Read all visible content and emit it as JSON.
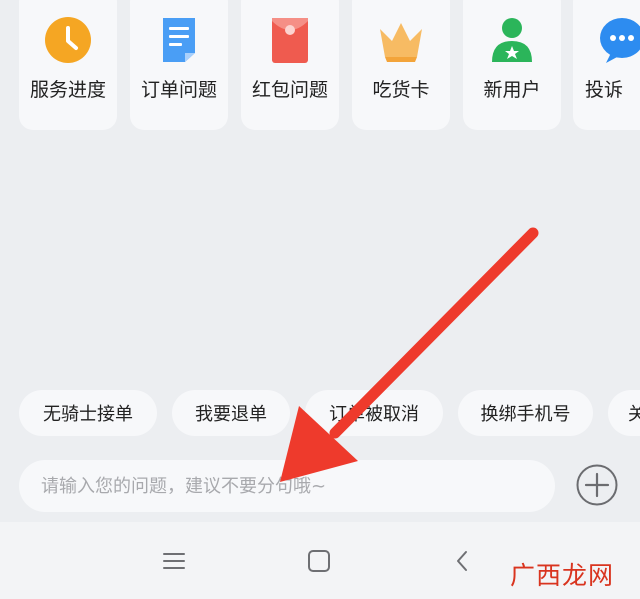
{
  "shortcuts": [
    {
      "label": "服务进度",
      "icon": "clock-icon",
      "color": "#f5a623"
    },
    {
      "label": "订单问题",
      "icon": "document-icon",
      "color": "#4a9ef5"
    },
    {
      "label": "红包问题",
      "icon": "red-envelope-icon",
      "color": "#ef5b4f"
    },
    {
      "label": "吃货卡",
      "icon": "crown-icon",
      "color": "#f7bb63"
    },
    {
      "label": "新用户",
      "icon": "new-user-icon",
      "color": "#2bb55a"
    },
    {
      "label": "投诉",
      "icon": "chat-bubble-icon",
      "color": "#2d8cf0"
    }
  ],
  "quick_replies": [
    "无骑士接单",
    "我要退单",
    "订单被取消",
    "换绑手机号",
    "关"
  ],
  "input": {
    "placeholder": "请输入您的问题，建议不要分句哦~",
    "value": ""
  },
  "nav": {
    "menu": "menu-icon",
    "home": "home-square-icon",
    "back": "back-chevron-icon"
  },
  "annotation": {
    "arrow_color": "#ee3a2c"
  },
  "watermark": "广西龙网"
}
